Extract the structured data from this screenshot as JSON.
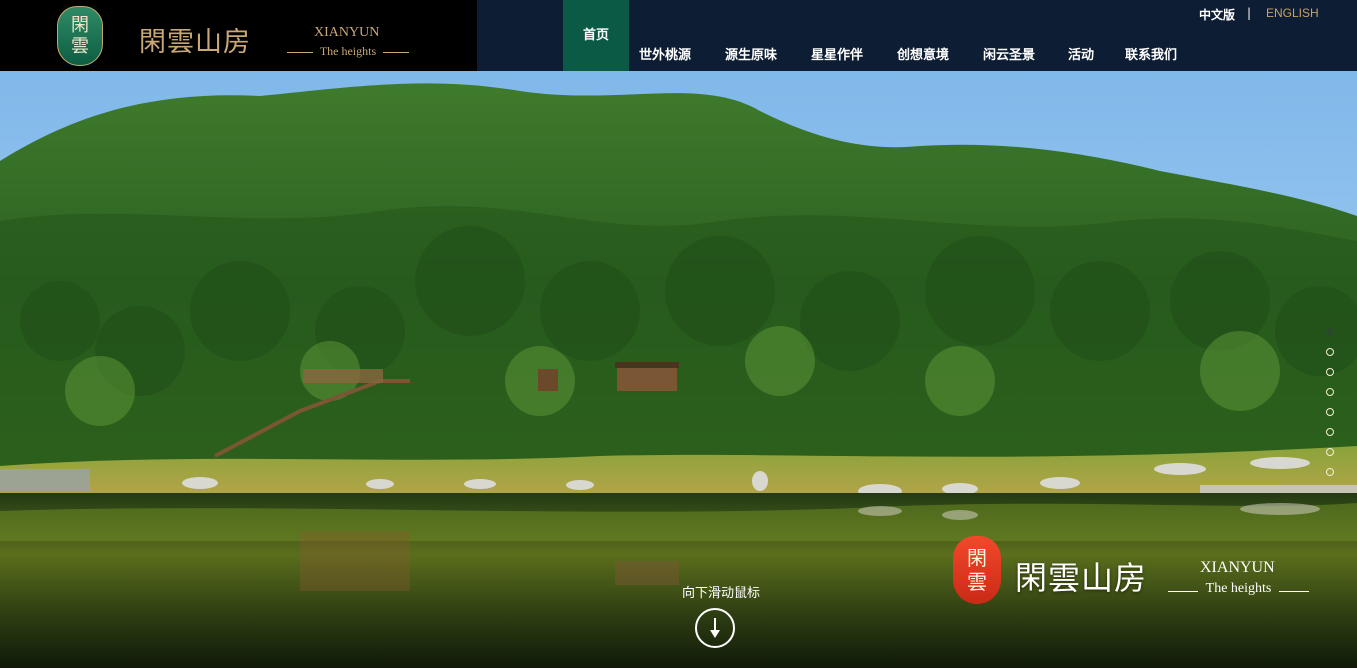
{
  "brand": {
    "seal_chars": [
      "閑",
      "雲"
    ],
    "name_cn": "閑雲山房",
    "name_en_1": "XIANYUN",
    "name_en_2": "The heights"
  },
  "language": {
    "cn": "中文版",
    "separator": "|",
    "en": "ENGLISH"
  },
  "nav": {
    "home": "首页",
    "items": [
      "世外桃源",
      "源生原味",
      "星星作伴",
      "创想意境",
      "闲云圣景",
      "活动",
      "联系我们"
    ]
  },
  "hero": {
    "scroll_hint": "向下滑动鼠标",
    "slide_count": 8,
    "active_slide": 1,
    "watermark": {
      "seal_chars": [
        "閑",
        "雲"
      ],
      "name_cn": "閑雲山房",
      "name_en_1": "XIANYUN",
      "name_en_2": "The heights"
    }
  },
  "colors": {
    "header_logo_bg": "#000000",
    "header_nav_bg": "#0d1d33",
    "nav_active_bg": "#0b5a45",
    "accent_gold": "#c9a25e",
    "seal_green": "#0d5e43",
    "seal_red": "#e0371f"
  }
}
